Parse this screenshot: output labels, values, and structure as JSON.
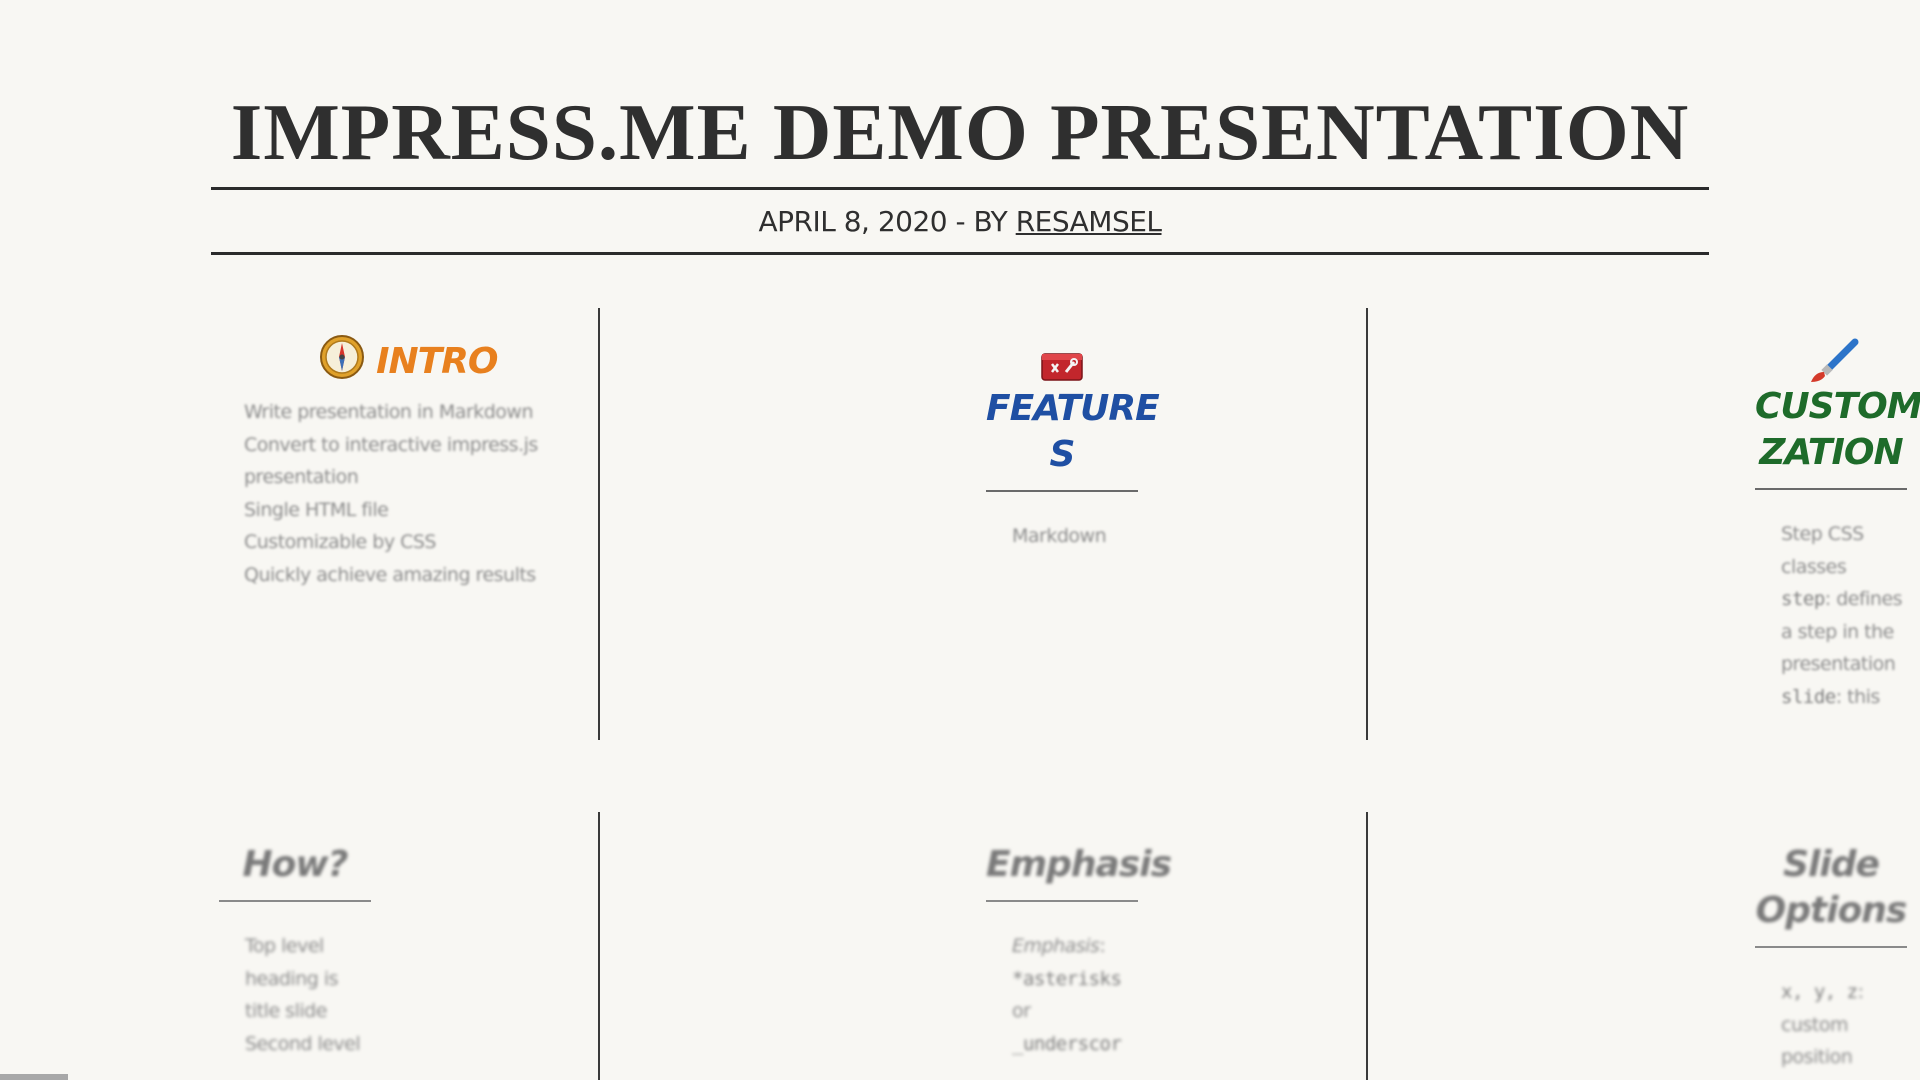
{
  "header": {
    "title": "IMPRESS.ME DEMO PRESENTATION",
    "byline_prefix": "APRIL 8, 2020 - BY",
    "author": "RESAMSEL"
  },
  "colors": {
    "intro": "#e8801e",
    "features": "#1f4fa3",
    "customization": "#1e6b2a",
    "muted": "#8d8d8d",
    "text": "#2f2f2f"
  },
  "steps": {
    "intro": {
      "icon": "compass-icon",
      "title": "INTRO",
      "lines": [
        "Write presentation in Markdown",
        "Convert to interactive impress.js",
        "presentation",
        "Single HTML file",
        "Customizable by CSS",
        "Quickly achieve amazing results"
      ]
    },
    "features": {
      "icon": "toolbox-icon",
      "title_1": "FEATURE",
      "title_2": "S",
      "lines": [
        "Markdown"
      ]
    },
    "customization": {
      "icon": "paintbrush-icon",
      "title_1": "CUSTOMI",
      "title_2": "ZATION",
      "lines": [
        "Step CSS",
        "classes",
        "step",
        ": defines",
        "a step in the",
        "presentation",
        "slide",
        ": this"
      ]
    },
    "how": {
      "title": "How?",
      "lines": [
        "Top level",
        "heading is",
        "title slide",
        "Second level"
      ]
    },
    "emphasis": {
      "title": "Emphasis",
      "lines": [
        "Emphasis",
        ":",
        "*asterisks",
        "or",
        "_underscor"
      ]
    },
    "slide_options": {
      "title_1": "Slide",
      "title_2": "Options",
      "lines": [
        "x, y, z",
        ":",
        "custom",
        "position"
      ]
    }
  }
}
